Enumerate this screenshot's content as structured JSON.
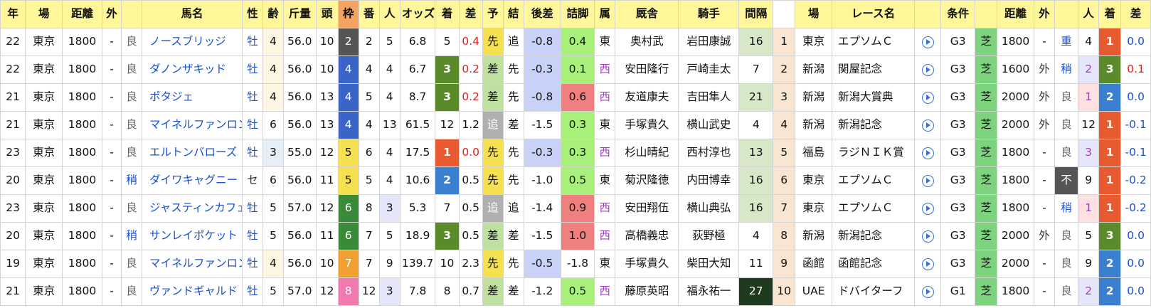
{
  "headers": [
    "年",
    "場",
    "距離",
    "外",
    "",
    "馬名",
    "性",
    "齢",
    "斤量",
    "頭",
    "枠",
    "番",
    "人",
    "オッズ",
    "着",
    "差",
    "予",
    "結",
    "後差",
    "詰脚",
    "属",
    "厩舎",
    "騎手",
    "間隔",
    "",
    "場",
    "レース名",
    "",
    "条件",
    "",
    "距離",
    "外",
    "",
    "人",
    "着",
    "差"
  ],
  "colors": {
    "header": "#fff799",
    "waku_header": "#f4a460",
    "gate": {
      "1": "#ffffff",
      "2": "#555555",
      "3": "#e03030",
      "4": "#3a64c8",
      "5": "#f5e050",
      "6": "#3a8a3a",
      "7": "#f0a030",
      "8": "#f07ab0"
    },
    "rank1": "#e85a30",
    "rank2": "#3a7fd0",
    "rank3": "#5a8a2a",
    "senkou": "#f5e050",
    "sashi": "#bfe0a0",
    "oikomi": "#b0b0b0",
    "shiba": "#7ed47e",
    "highlight_blue": "#c8d2f8",
    "highlight_green": "#a8f07a",
    "highlight_red": "#f08080"
  },
  "rows": [
    [
      "22",
      "東京",
      "1800",
      "-",
      "良",
      "ノースブリッジ",
      "牡",
      "4",
      "56.0",
      "10",
      "2",
      "2",
      "5",
      "6.8",
      "5",
      "0.4",
      "先",
      "追",
      "-0.8",
      "0.4",
      "東",
      "奥村武",
      "岩田康誠",
      "16",
      "1",
      "東京",
      "エプソムＣ",
      "play",
      "G3",
      "芝",
      "1800",
      "-",
      "重",
      "4",
      "1",
      "0.0"
    ],
    [
      "22",
      "東京",
      "1800",
      "-",
      "良",
      "ダノンザキッド",
      "牡",
      "4",
      "56.0",
      "10",
      "4",
      "4",
      "4",
      "6.7",
      "3",
      "0.2",
      "差",
      "先",
      "-0.3",
      "0.1",
      "西",
      "安田隆行",
      "戸崎圭太",
      "7",
      "2",
      "新潟",
      "関屋記念",
      "play",
      "G3",
      "芝",
      "1600",
      "外",
      "稍",
      "2",
      "3",
      "0.1"
    ],
    [
      "21",
      "東京",
      "1800",
      "-",
      "良",
      "ポタジェ",
      "牡",
      "4",
      "56.0",
      "13",
      "4",
      "5",
      "4",
      "8.7",
      "3",
      "0.2",
      "差",
      "先",
      "-0.8",
      "0.6",
      "西",
      "友道康夫",
      "吉田隼人",
      "21",
      "3",
      "新潟",
      "新潟大賞典",
      "play",
      "G3",
      "芝",
      "2000",
      "外",
      "良",
      "1",
      "2",
      "0.0"
    ],
    [
      "21",
      "東京",
      "1800",
      "-",
      "良",
      "マイネルファンロン",
      "牡",
      "6",
      "56.0",
      "13",
      "4",
      "4",
      "13",
      "61.5",
      "12",
      "1.2",
      "追",
      "差",
      "-1.5",
      "0.3",
      "東",
      "手塚貴久",
      "横山武史",
      "4",
      "4",
      "新潟",
      "新潟記念",
      "play",
      "G3",
      "芝",
      "2000",
      "外",
      "良",
      "12",
      "1",
      "-0.1"
    ],
    [
      "23",
      "東京",
      "1800",
      "-",
      "良",
      "エルトンバローズ",
      "牡",
      "3",
      "55.0",
      "12",
      "5",
      "6",
      "4",
      "17.5",
      "1",
      "0.0",
      "先",
      "先",
      "-0.3",
      "0.3",
      "西",
      "杉山晴紀",
      "西村淳也",
      "13",
      "5",
      "福島",
      "ラジＮＩＫ賞",
      "play",
      "G3",
      "芝",
      "1800",
      "-",
      "良",
      "3",
      "1",
      "-0.1"
    ],
    [
      "20",
      "東京",
      "1800",
      "-",
      "稍",
      "ダイワキャグニー",
      "セ",
      "6",
      "56.0",
      "11",
      "5",
      "5",
      "4",
      "10.6",
      "2",
      "0.5",
      "先",
      "先",
      "-1.0",
      "0.5",
      "東",
      "菊沢隆徳",
      "内田博幸",
      "16",
      "6",
      "東京",
      "エプソムＣ",
      "play",
      "G3",
      "芝",
      "1800",
      "-",
      "不",
      "9",
      "1",
      "-0.2"
    ],
    [
      "23",
      "東京",
      "1800",
      "-",
      "良",
      "ジャスティンカフェ",
      "牡",
      "5",
      "57.0",
      "12",
      "6",
      "8",
      "3",
      "5.3",
      "7",
      "0.5",
      "追",
      "追",
      "-1.4",
      "0.9",
      "西",
      "安田翔伍",
      "横山典弘",
      "16",
      "7",
      "東京",
      "エプソムＣ",
      "play",
      "G3",
      "芝",
      "1800",
      "-",
      "稍",
      "1",
      "1",
      "-0.2"
    ],
    [
      "20",
      "東京",
      "1800",
      "-",
      "稍",
      "サンレイポケット",
      "牡",
      "5",
      "56.0",
      "11",
      "6",
      "7",
      "5",
      "18.9",
      "3",
      "0.5",
      "差",
      "差",
      "-1.5",
      "1.0",
      "西",
      "高橋義忠",
      "荻野極",
      "4",
      "8",
      "新潟",
      "新潟記念",
      "play",
      "G3",
      "芝",
      "2000",
      "外",
      "良",
      "5",
      "3",
      "0.0"
    ],
    [
      "19",
      "東京",
      "1800",
      "-",
      "良",
      "マイネルファンロン",
      "牡",
      "4",
      "56.0",
      "10",
      "7",
      "7",
      "9",
      "139.7",
      "10",
      "2.3",
      "先",
      "先",
      "-0.5",
      "-1.8",
      "東",
      "手塚貴久",
      "柴田大知",
      "11",
      "9",
      "函館",
      "函館記念",
      "play",
      "G3",
      "芝",
      "2000",
      "-",
      "良",
      "9",
      "2",
      "0.0"
    ],
    [
      "21",
      "東京",
      "1800",
      "-",
      "良",
      "ヴァンドギャルド",
      "牡",
      "5",
      "57.0",
      "12",
      "8",
      "12",
      "3",
      "7.8",
      "8",
      "0.7",
      "差",
      "差",
      "-1.2",
      "0.5",
      "西",
      "藤原英昭",
      "福永祐一",
      "27",
      "10",
      "UAE",
      "ドバイターフ",
      "play",
      "G1",
      "芝",
      "1800",
      "-",
      "良",
      "2",
      "2",
      "0.0"
    ]
  ]
}
